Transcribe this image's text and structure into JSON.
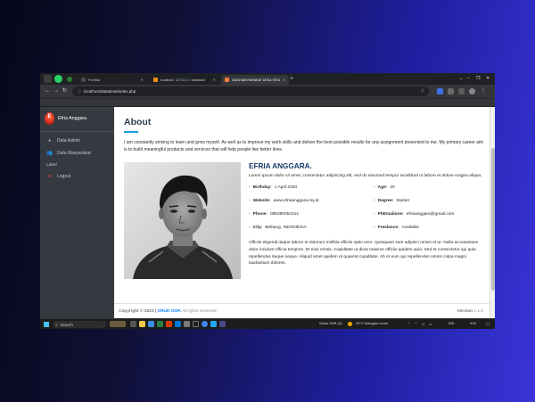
{
  "browser": {
    "tabs": [
      {
        "title": "Portfolio",
        "icon_color": "#4a4a4a",
        "active": false
      },
      {
        "title": "localhost / 127.0.0.1 / database",
        "icon_color": "#f29111",
        "active": false
      },
      {
        "title": "DATA MASYARAKAT DESA TEGA",
        "icon_color": "#f37c3d",
        "active": true
      }
    ],
    "url": "localhost/datadesa/index.php"
  },
  "sidebar": {
    "brand_initial": "E",
    "brand_name": "Efria Anggara",
    "items": [
      {
        "label": "Data Admin",
        "icon": "palette-icon"
      },
      {
        "label": "Data Masyarakat",
        "icon": "users-icon"
      }
    ],
    "section_label": "Label",
    "logout_label": "Logout"
  },
  "about": {
    "title": "About",
    "intro": "I am constantly striving to learn and grow myself. As well as to improve my work skills and deliver the best possible results for any assignment presented to me. My primary career aim is to build meaningful products and services that will help people live better lives.",
    "name": "EFRIA ANGGARA.",
    "tagline": "Lorem ipsum dolor sit amet, consectetur adipiscing elit, sed do eiusmod tempor incididunt ut labore et dolore magna aliqua.",
    "facts_left": [
      {
        "label": "Birthday:",
        "value": "1 April 2003"
      },
      {
        "label": "Website:",
        "value": "www.efriaanggara.my.id"
      },
      {
        "label": "Phone:",
        "value": "085380054312"
      },
      {
        "label": "City:",
        "value": "Belitang, INDONESIA"
      }
    ],
    "facts_right": [
      {
        "label": "Age:",
        "value": "20"
      },
      {
        "label": "Degree:",
        "value": "Master"
      },
      {
        "label": "PhEmailone:",
        "value": "efriaanggara@gmail.com"
      },
      {
        "label": "Freelance:",
        "value": "Available"
      }
    ],
    "description": "Officiis eligendi itaque labore et dolorum mollitia officiis optio vero. Quisquam sunt adipisci omnis et ut. Nulla accusantium dolor incidunt officia tempore. Et eius omnis. Cupiditate ut dicta maxime officiis quidem quia. Sed et consectetur qui quia repellendus itaque neque. Aliquid amet quidem ut quaerat cupiditate. Ab et eum qui repellendus omnis culpa magni laudantium dolores."
  },
  "footer": {
    "copyright_prefix": "Copyright © 2023 |",
    "brand": "CRUD OOP.",
    "suffix": "All rights reserved.",
    "version_label": "Version",
    "version": "1.1.0"
  },
  "taskbar": {
    "search_placeholder": "Search",
    "tray_info": "Saran DNR (D)",
    "weather": "29°C  Sebagian cerah",
    "lang": "IND",
    "time": "9:52"
  }
}
